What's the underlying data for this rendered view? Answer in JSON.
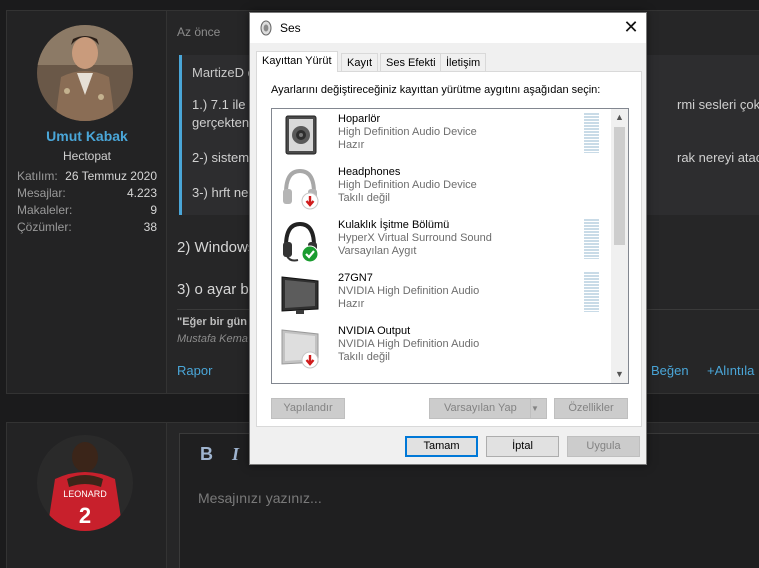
{
  "forum": {
    "post_time": "Az önce",
    "user": {
      "name": "Umut Kabak",
      "title": "Hectopat",
      "stats": [
        {
          "label": "Katılım:",
          "value": "26 Temmuz 2020"
        },
        {
          "label": "Mesajlar:",
          "value": "4.223"
        },
        {
          "label": "Makaleler:",
          "value": "9"
        },
        {
          "label": "Çözümler:",
          "value": "38"
        }
      ]
    },
    "quote": {
      "author": "MartizeD d",
      "line1_left": "1.) 7.1 ile c",
      "line1_right": "rmi sesleri çok tuhaf",
      "line2_left": "gerçekten",
      "line3_left": "2-) sistem",
      "line3_right": "rak nereyi atacağım",
      "line4_left": "3-) hrft ne"
    },
    "text1": "2) Windows",
    "text2": "3) o ayar ba",
    "sig_title": "\"Eğer bir gün",
    "sig_author": "Mustafa Kema",
    "report": "Rapor",
    "like": "Beğen",
    "quote_action": "Alıntıla",
    "editor": {
      "bold": "B",
      "italic": "I",
      "placeholder": "Mesajınızı yazınız..."
    }
  },
  "dialog": {
    "title": "Ses",
    "tabs": [
      "Kayıttan Yürüt",
      "Kayıt",
      "Ses Efekti",
      "İletişim"
    ],
    "instruction": "Ayarlarını değiştireceğiniz kayıttan yürütme aygıtını aşağıdan seçin:",
    "devices": [
      {
        "name": "Hoparlör",
        "desc": "High Definition Audio Device",
        "status": "Hazır"
      },
      {
        "name": "Headphones",
        "desc": "High Definition Audio Device",
        "status": "Takılı değil"
      },
      {
        "name": "Kulaklık İşitme Bölümü",
        "desc": "HyperX Virtual Surround Sound",
        "status": "Varsayılan Aygıt"
      },
      {
        "name": "27GN7",
        "desc": "NVIDIA High Definition Audio",
        "status": "Hazır"
      },
      {
        "name": "NVIDIA Output",
        "desc": "NVIDIA High Definition Audio",
        "status": "Takılı değil"
      }
    ],
    "buttons": {
      "configure": "Yapılandır",
      "set_default": "Varsayılan Yap",
      "properties": "Özellikler",
      "ok": "Tamam",
      "cancel": "İptal",
      "apply": "Uygula"
    },
    "close_symbol": "✕"
  }
}
